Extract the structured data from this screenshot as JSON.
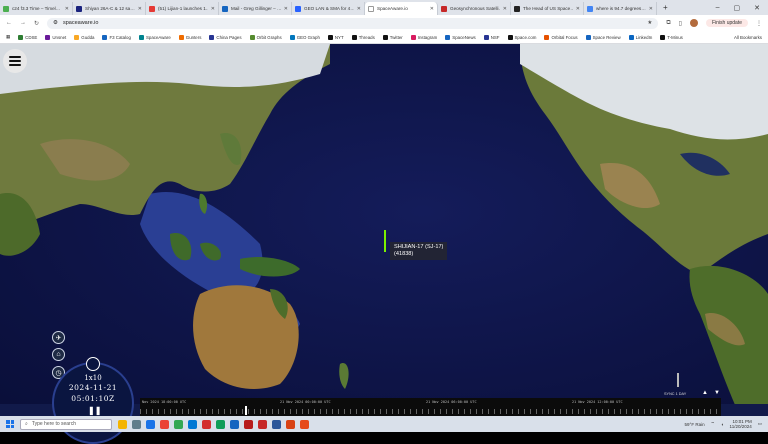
{
  "browser": {
    "tabs": [
      {
        "title": "c24 f3.3 Time – Timel…",
        "color": "#4caf50"
      },
      {
        "title": "Shiyan 26A-C & 12 sa…",
        "color": "#1a237e"
      },
      {
        "title": "(51) Lijian-1 launches 1…",
        "color": "#e53935"
      },
      {
        "title": "Mail - Greg Gillinger – …",
        "color": "#1565c0"
      },
      {
        "title": "GEO LAN & SMA for 4…",
        "color": "#2962ff"
      },
      {
        "title": "SpaceAware.io",
        "color": "#ffffff",
        "active": true
      },
      {
        "title": "Geosynchronous Satelli…",
        "color": "#c62828"
      },
      {
        "title": "The Head of US Space…",
        "color": "#212121"
      },
      {
        "title": "where is 94.7 degrees…",
        "color": "#4285f4"
      }
    ],
    "url": "spaceaware.io",
    "finish_update": "Finish update",
    "bookmarks": [
      {
        "label": "CDSE",
        "color": "#2e7d32"
      },
      {
        "label": "Unsnet",
        "color": "#6a1b9a"
      },
      {
        "label": "Gudda",
        "color": "#f9a825"
      },
      {
        "label": "F3 Catalog",
        "color": "#1565c0"
      },
      {
        "label": "SpaceAware",
        "color": "#00838f"
      },
      {
        "label": "Gunters",
        "color": "#ef6c00"
      },
      {
        "label": "China Pages",
        "color": "#283593"
      },
      {
        "label": "Orbit Graphs",
        "color": "#558b2f"
      },
      {
        "label": "GEO Graph",
        "color": "#0277bd"
      },
      {
        "label": "NYT",
        "color": "#111111"
      },
      {
        "label": "Threads",
        "color": "#111111"
      },
      {
        "label": "Twitter",
        "color": "#111111"
      },
      {
        "label": "Instagram",
        "color": "#d81b60"
      },
      {
        "label": "SpaceNews",
        "color": "#1565c0"
      },
      {
        "label": "NSF",
        "color": "#283593"
      },
      {
        "label": "Space.com",
        "color": "#111111"
      },
      {
        "label": "Orbital Focus",
        "color": "#e65100"
      },
      {
        "label": "Space Review",
        "color": "#1565c0"
      },
      {
        "label": "LinkedIn",
        "color": "#0a66c2"
      },
      {
        "label": "T-Minus",
        "color": "#111111"
      }
    ],
    "all_bookmarks": "All Bookmarks"
  },
  "app": {
    "satellite": {
      "name": "SHIJIAN-17 (SJ-17)",
      "id": "(41838)"
    },
    "clock": {
      "speed": "1x10",
      "date": "2024-11-21",
      "time": "05:01:10Z"
    },
    "timeline": {
      "labels": [
        "Nov 2024 18:00:00 UTC",
        "21 Nov 2024 00:00:00 UTC",
        "21 Nov 2024 06:00:00 UTC",
        "21 Nov 2024 12:00:00 UTC"
      ]
    },
    "sync_label": "SYNC  1 DAY"
  },
  "taskbar": {
    "search_placeholder": "Type here to search",
    "weather": "59°F  Rain",
    "time": "10:01 PM",
    "date": "11/20/2024",
    "app_colors": [
      "#f4b400",
      "#607d8b",
      "#1a73e8",
      "#ea4335",
      "#34a853",
      "#0078d4",
      "#d32f2f",
      "#0f9d58",
      "#1565c0",
      "#b71c1c",
      "#c62828",
      "#2b579a",
      "#d84315",
      "#e64a19"
    ]
  }
}
